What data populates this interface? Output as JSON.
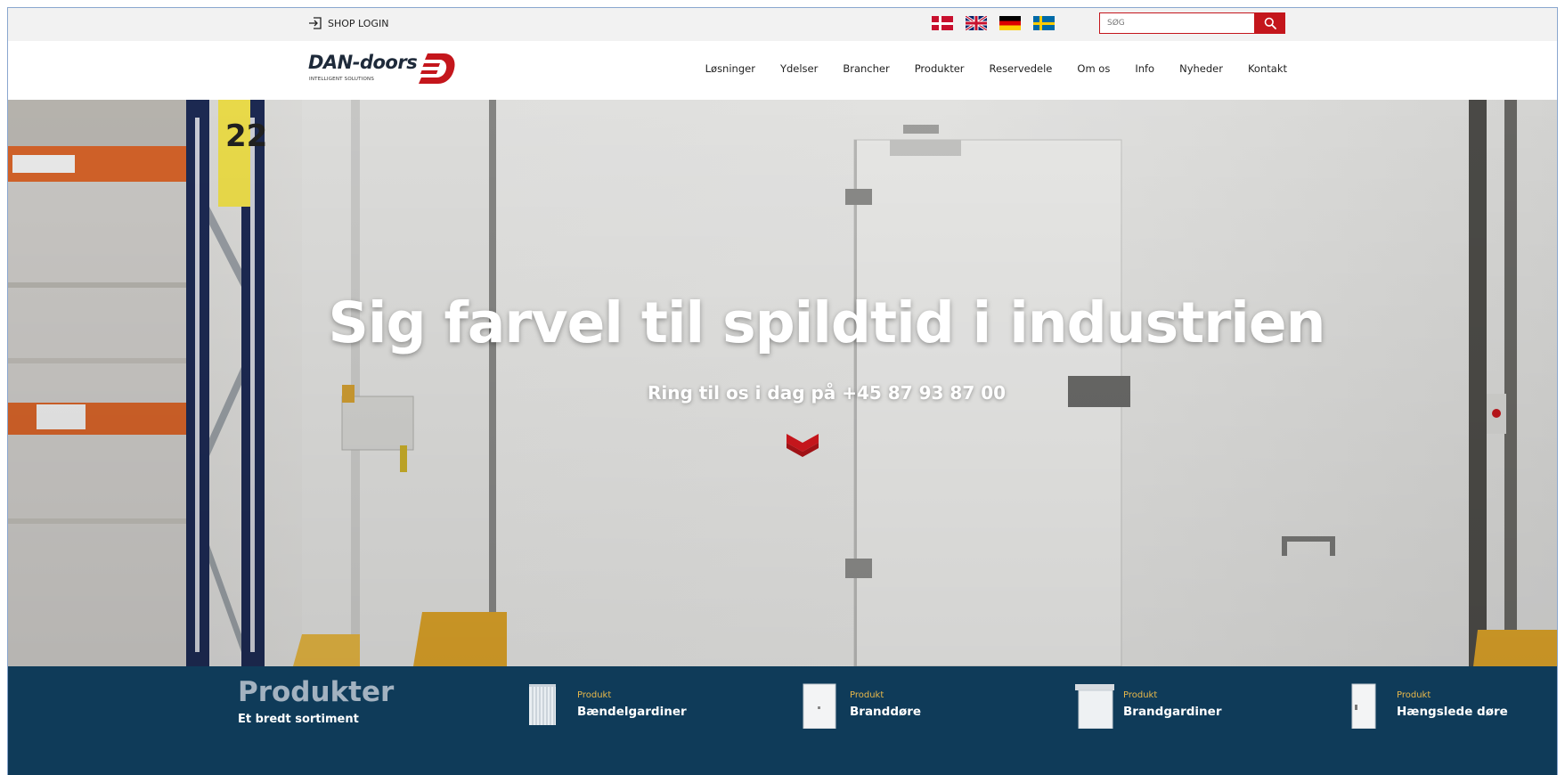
{
  "topbar": {
    "shop_login_label": "SHOP LOGIN",
    "shop_login_icon": "login-arrow-icon",
    "languages": [
      {
        "name": "Dansk",
        "icon": "flag-denmark-icon"
      },
      {
        "name": "English",
        "icon": "flag-uk-icon"
      },
      {
        "name": "Deutsch",
        "icon": "flag-germany-icon"
      },
      {
        "name": "Svenska",
        "icon": "flag-sweden-icon"
      }
    ],
    "search": {
      "placeholder": "SØG",
      "button_icon": "search-icon"
    }
  },
  "header": {
    "logo_text": "DAN-doors",
    "logo_tagline": "INTELLIGENT SOLUTIONS",
    "nav": [
      "Løsninger",
      "Ydelser",
      "Brancher",
      "Produkter",
      "Reservedele",
      "Om os",
      "Info",
      "Nyheder",
      "Kontakt"
    ]
  },
  "hero": {
    "title": "Sig farvel til spildtid i industrien",
    "subtitle": "Ring til os i dag på +45 87 93 87 00",
    "scroll_icon": "chevron-down-icon",
    "rack_label_top": "22"
  },
  "products": {
    "title": "Produkter",
    "subtitle": "Et bredt sortiment",
    "items": [
      {
        "kicker": "Produkt",
        "name": "Bændelgardiner"
      },
      {
        "kicker": "Produkt",
        "name": "Branddøre"
      },
      {
        "kicker": "Produkt",
        "name": "Brandgardiner"
      },
      {
        "kicker": "Produkt",
        "name": "Hængslede døre"
      }
    ]
  },
  "colors": {
    "brand_red": "#c4161c",
    "products_bar": "#0f3b59",
    "kicker": "#e8b84a"
  }
}
